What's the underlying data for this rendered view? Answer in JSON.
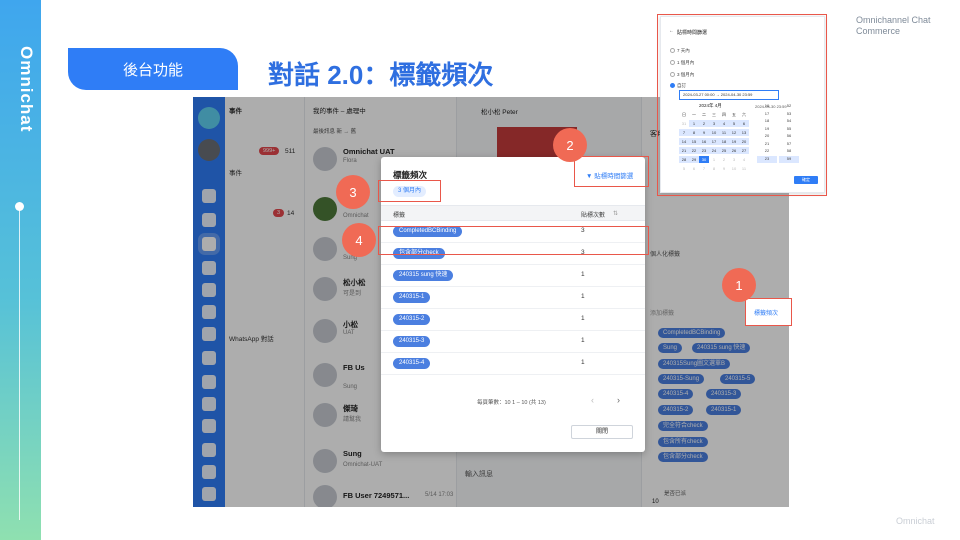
{
  "brand": {
    "logo_text": "Omnichat"
  },
  "header": {
    "section_label": "後台功能",
    "title": "對話 2.0：標籤頻次",
    "corner_text": "Omnichannel Chat Commerce"
  },
  "footer": {
    "watermark": "Omnichat"
  },
  "app": {
    "col1": {
      "header": "事件",
      "rows": [
        {
          "label": "事件",
          "badge": "999+",
          "count": "511"
        },
        {
          "label": "",
          "badge": "3",
          "count": "14"
        },
        {
          "label": "WhatsApp 對話"
        }
      ]
    },
    "col2": {
      "header": "我的事件 – 處理中",
      "filter": "最後訊息 新 → 舊",
      "conversations": [
        {
          "name": "Omnichat UAT",
          "sub": "Flora"
        },
        {
          "name": "",
          "sub": "Omnichat"
        },
        {
          "name": "",
          "sub": "Sung"
        },
        {
          "name": "松小松",
          "sub": "可是到"
        },
        {
          "name": "小松",
          "sub": "UAT"
        },
        {
          "name": "FB Us",
          "sub": "Sung"
        },
        {
          "name": "傑琦",
          "sub": "請幫我"
        },
        {
          "name": "Sung",
          "sub": "Omnichat-UAT"
        },
        {
          "name": "FB User 7249571...",
          "sub": "5/14 17:03"
        }
      ]
    },
    "col3": {
      "header": "松小松 Peter",
      "input_placeholder": "輸入訊息"
    },
    "col4": {
      "header": "客戶",
      "personal_tag": "個人化標籤",
      "add_tag": "添加標籤",
      "tag_freq_link": "標籤頻次",
      "tags": [
        "CompletedBCBinding",
        "Sung",
        "240315 sung 快速",
        "240315Sung圖文選單B",
        "240315-Sung",
        "240315-5",
        "240315-4",
        "240315-3",
        "240315-2",
        "240315-1",
        "完全符合check",
        "包含所有check",
        "包含部分check"
      ],
      "bottom_label": "是否已派",
      "bottom_value": "10"
    }
  },
  "modal": {
    "title": "標籤頻次",
    "filter_link": "貼標時間篩選",
    "active_filter": "3 個月內",
    "columns": {
      "tag": "標籤",
      "count": "貼標次數"
    },
    "rows": [
      {
        "tag": "CompletedBCBinding",
        "count": "3"
      },
      {
        "tag": "包含部分check",
        "count": "3"
      },
      {
        "tag": "240315 sung 快速",
        "count": "1"
      },
      {
        "tag": "240315-1",
        "count": "1"
      },
      {
        "tag": "240315-2",
        "count": "1"
      },
      {
        "tag": "240315-3",
        "count": "1"
      },
      {
        "tag": "240315-4",
        "count": "1"
      }
    ],
    "pager": "每頁筆數：10   1 – 10 (共 13)",
    "close_label": "關閉"
  },
  "inset": {
    "title": "貼標時間篩選",
    "options": [
      "7 天內",
      "1 個月內",
      "3 個月內",
      "自訂"
    ],
    "range_text": "2024-03-27 00:00  →  2024-04-30 23:59",
    "month_label": "2024年 4月",
    "weekdays": [
      "日",
      "一",
      "二",
      "三",
      "四",
      "五",
      "六"
    ],
    "days": [
      "31",
      "1",
      "2",
      "3",
      "4",
      "5",
      "6",
      "7",
      "8",
      "9",
      "10",
      "11",
      "12",
      "13",
      "14",
      "15",
      "16",
      "17",
      "18",
      "19",
      "20",
      "21",
      "22",
      "23",
      "24",
      "25",
      "26",
      "27",
      "28",
      "29",
      "30",
      "1",
      "2",
      "3",
      "4",
      "5",
      "6",
      "7",
      "8",
      "9",
      "10",
      "11"
    ],
    "time_header": "2024-04-30 23:59",
    "hours": [
      "16",
      "17",
      "18",
      "19",
      "20",
      "21",
      "22",
      "23"
    ],
    "minutes": [
      "52",
      "53",
      "54",
      "55",
      "56",
      "57",
      "58",
      "59"
    ],
    "ok_label": "確定"
  },
  "callouts": [
    "1",
    "2",
    "3",
    "4"
  ],
  "colors": {
    "accent": "#2f7df6",
    "highlight": "#e9574a",
    "callout": "#f06a55"
  }
}
